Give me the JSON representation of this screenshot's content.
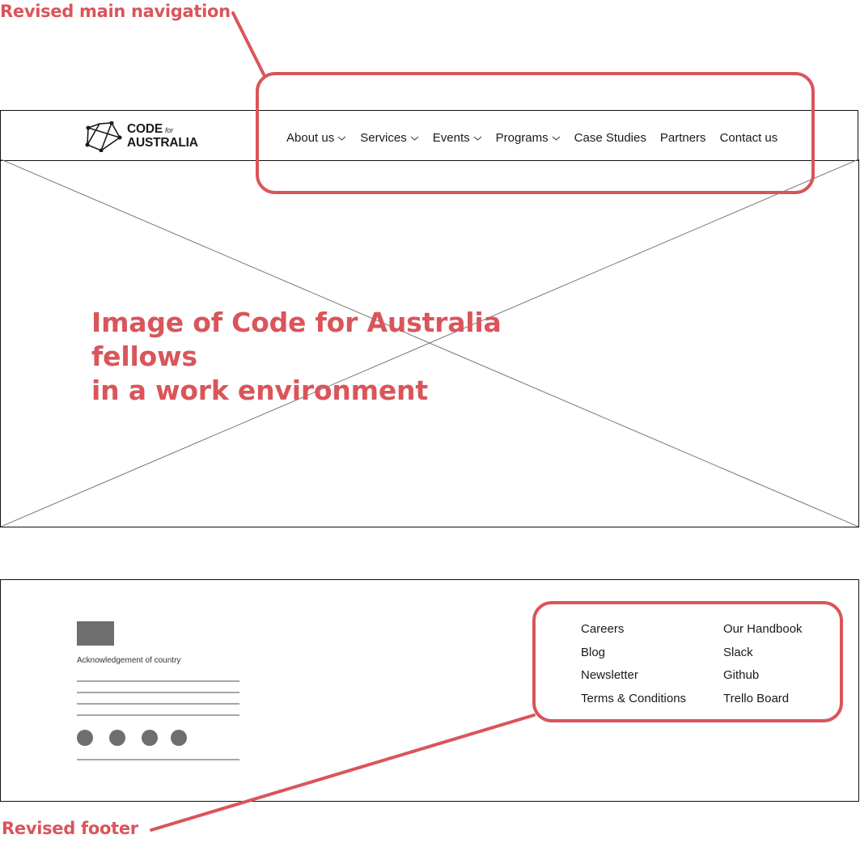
{
  "annotations": {
    "top_label": "Revised main navigation",
    "bottom_label": "Revised footer",
    "color": "#d9555a"
  },
  "header": {
    "logo": {
      "line1": "CODE",
      "for": "for",
      "line2": "AUSTRALIA"
    },
    "nav": [
      {
        "label": "About us",
        "has_dropdown": true
      },
      {
        "label": "Services",
        "has_dropdown": true
      },
      {
        "label": "Events",
        "has_dropdown": true
      },
      {
        "label": "Programs",
        "has_dropdown": true
      },
      {
        "label": "Case Studies",
        "has_dropdown": false
      },
      {
        "label": "Partners",
        "has_dropdown": false
      },
      {
        "label": "Contact us",
        "has_dropdown": false
      }
    ]
  },
  "hero": {
    "caption_line1": "Image of Code for Australia fellows",
    "caption_line2": "in a work environment"
  },
  "footer": {
    "acknowledgement": "Acknowledgement of country",
    "social_icon_count": 4,
    "links_col1": [
      "Careers",
      "Blog",
      "Newsletter",
      "Terms & Conditions"
    ],
    "links_col2": [
      "Our Handbook",
      "Slack",
      "Github",
      "Trello Board"
    ]
  }
}
